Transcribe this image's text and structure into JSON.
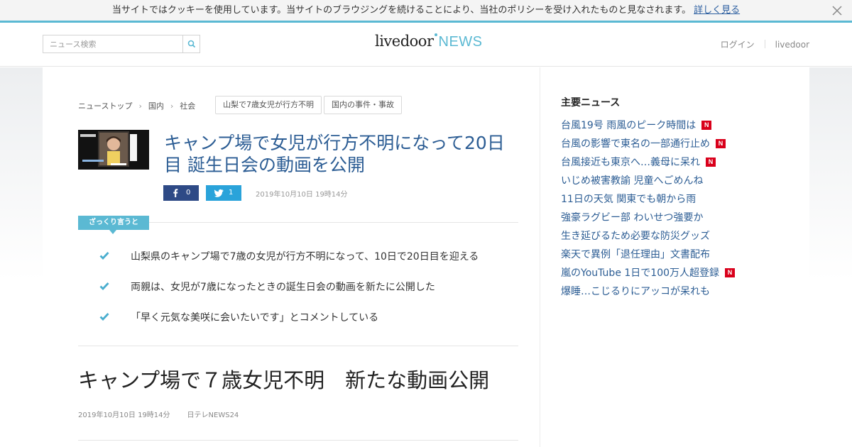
{
  "cookie_bar": {
    "text": "当サイトではクッキーを使用しています。当サイトのブラウジングを続けることにより、当社のポリシーを受け入れたものと見なされます。",
    "link": "詳しく見る"
  },
  "header": {
    "search_placeholder": "ニュース検索",
    "logo_main": "livedoor",
    "logo_news": "NEWS",
    "login": "ログイン",
    "livedoor_link": "livedoor"
  },
  "breadcrumb": [
    "ニューストップ",
    "国内",
    "社会"
  ],
  "tags": [
    "山梨で7歳女児が行方不明",
    "国内の事件・事故"
  ],
  "article": {
    "title": "キャンプ場で女児が行方不明になって20日目 誕生日会の動画を公開",
    "facebook_count": "0",
    "twitter_count": "1",
    "date": "2019年10月10日 19時14分",
    "summary_label": "ざっくり言うと",
    "summary": [
      "山梨県のキャンプ場で7歳の女児が行方不明になって、10日で20日目を迎える",
      "両親は、女児が7歳になったときの誕生日会の動画を新たに公開した",
      "「早く元気な美咲に会いたいです」とコメントしている"
    ],
    "headline": "キャンプ場で７歳女児不明　新たな動画公開",
    "headline_date": "2019年10月10日 19時14分",
    "source": "日テレNEWS24"
  },
  "sidebar": {
    "title": "主要ニュース",
    "items": [
      {
        "label": "台風19号 雨風のピーク時間は",
        "badge": "N"
      },
      {
        "label": "台風の影響で東名の一部通行止め",
        "badge": "N"
      },
      {
        "label": "台風接近も東京へ…義母に呆れ",
        "badge": "N"
      },
      {
        "label": "いじめ被害教諭 児童へごめんね",
        "badge": ""
      },
      {
        "label": "11日の天気 関東でも朝から雨",
        "badge": ""
      },
      {
        "label": "強豪ラグビー部 わいせつ強要か",
        "badge": ""
      },
      {
        "label": "生き延びるため必要な防災グッズ",
        "badge": ""
      },
      {
        "label": "楽天で異例「退任理由」文書配布",
        "badge": ""
      },
      {
        "label": "嵐のYouTube 1日で100万人超登録",
        "badge": "N"
      },
      {
        "label": "爆睡…こじるりにアッコが呆れも",
        "badge": ""
      }
    ]
  },
  "colors": {
    "accent": "#5bb9d3",
    "title_blue": "#2c5d94",
    "facebook": "#2e4a86",
    "twitter": "#2aa3da",
    "new_badge": "#d9001b"
  }
}
